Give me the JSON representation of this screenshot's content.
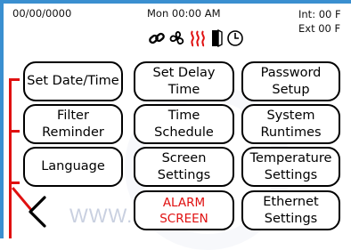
{
  "status_bar": {
    "date": "00/00/0000",
    "day_time": "Mon 00:00 AM",
    "int_temp": "Int: 00 F",
    "ext_temp": "Ext  00 F"
  },
  "status_icons": [
    "link-icon",
    "fan-icon",
    "heat-icon",
    "door-icon",
    "clock-icon"
  ],
  "colors": {
    "frame": "#3a8fd0",
    "alarm_text": "#e01010",
    "bracket": "#e01010",
    "heat_icon": "#e01010"
  },
  "watermark": "WWW.F",
  "buttons": {
    "set_date_time": "Set Date/Time",
    "set_delay_time": "Set Delay Time",
    "password_setup": "Password\nSetup",
    "filter_reminder": "Filter Reminder",
    "time_schedule": "Time Schedule",
    "system_runtimes": "System\nRuntimes",
    "language": "Language",
    "screen_settings": "Screen\nSettings",
    "temperature_settings": "Temperature\nSettings",
    "alarm_screen": "ALARM\nSCREEN",
    "ethernet_settings": "Ethernet\nSettings"
  }
}
